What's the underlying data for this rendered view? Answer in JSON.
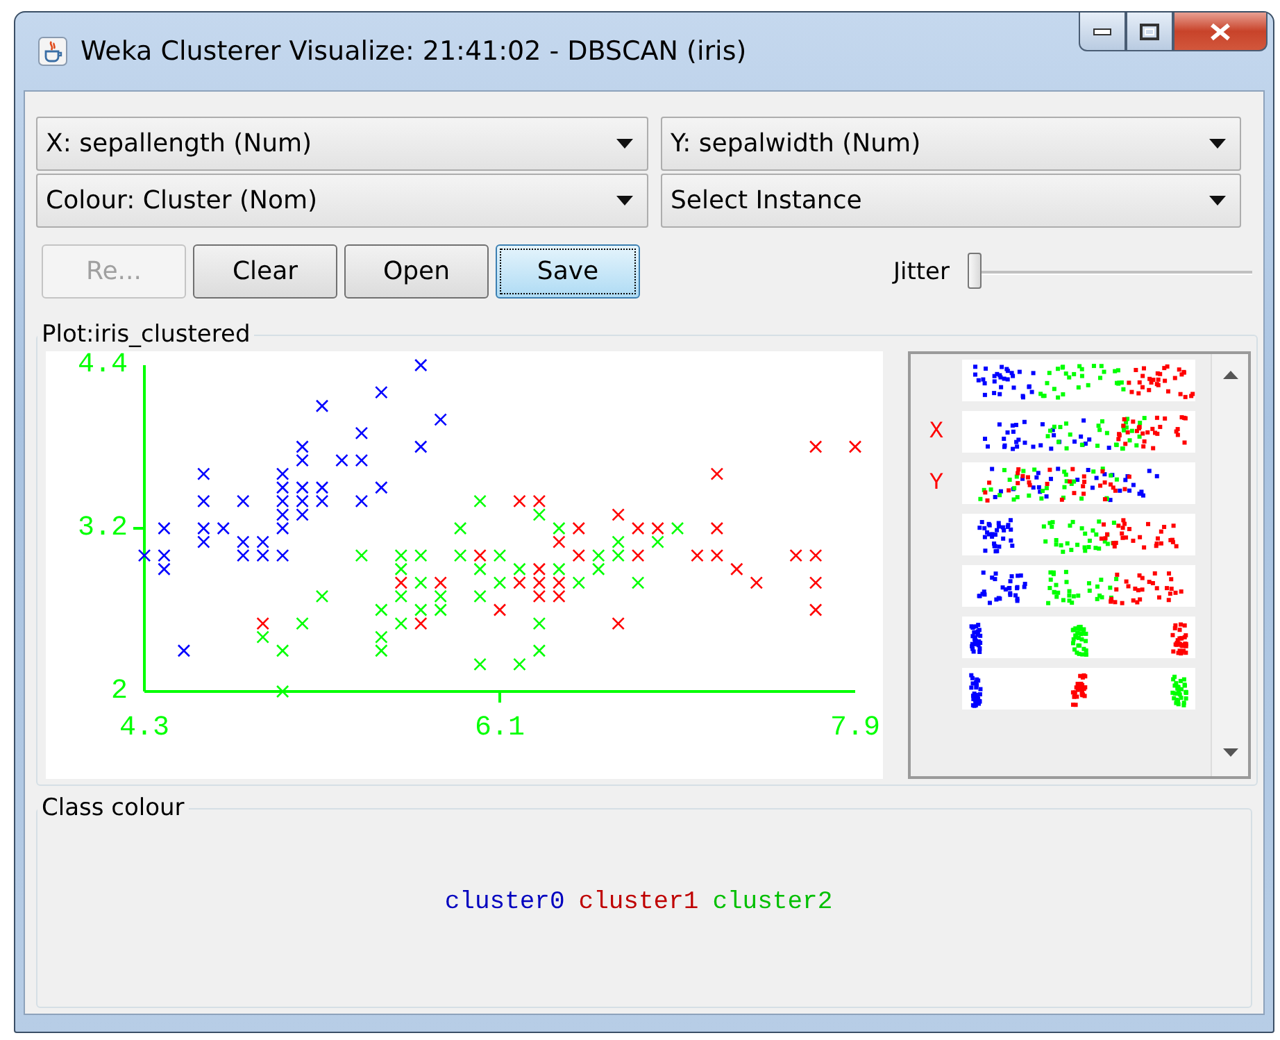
{
  "window": {
    "title": "Weka Clusterer Visualize: 21:41:02 - DBSCAN (iris)"
  },
  "selectors": [
    {
      "text": "X: sepallength (Num)"
    },
    {
      "text": "Y: sepalwidth (Num)"
    },
    {
      "text": "Colour: Cluster (Nom)"
    },
    {
      "text": "Select Instance"
    }
  ],
  "buttons": [
    {
      "label": "Re...",
      "disabled": true,
      "focused": false
    },
    {
      "label": "Clear",
      "disabled": false,
      "focused": false
    },
    {
      "label": "Open",
      "disabled": false,
      "focused": false
    },
    {
      "label": "Save",
      "disabled": false,
      "focused": true
    }
  ],
  "jitter": {
    "label": "Jitter",
    "level": 0
  },
  "plot": {
    "title": "Plot:iris_clustered",
    "chart_data": {
      "type": "scatter",
      "xlim": [
        4.3,
        7.9
      ],
      "ylim": [
        2,
        4.4
      ],
      "xticks": [
        {
          "value": 4.3,
          "label": "4.3"
        },
        {
          "value": 6.1,
          "label": "6.1"
        },
        {
          "value": 7.9,
          "label": "7.9"
        }
      ],
      "yticks": [
        {
          "value": 2,
          "label": "2"
        },
        {
          "value": 3.2,
          "label": "3.2"
        },
        {
          "value": 4.4,
          "label": "4.4"
        }
      ],
      "series": [
        {
          "name": "cluster0",
          "color": "#0000ff",
          "x": [
            4.3,
            4.4,
            4.4,
            4.4,
            4.5,
            4.6,
            4.6,
            4.6,
            4.6,
            4.7,
            4.8,
            4.8,
            4.8,
            4.9,
            4.9,
            5.0,
            5.0,
            5.0,
            5.0,
            5.0,
            5.0,
            5.1,
            5.1,
            5.1,
            5.1,
            5.1,
            5.2,
            5.2,
            5.2,
            5.3,
            5.4,
            5.4,
            5.4,
            5.5,
            5.5,
            5.7,
            5.7,
            5.8
          ],
          "values": [
            3.0,
            3.2,
            3.0,
            2.9,
            2.3,
            3.6,
            3.4,
            3.2,
            3.1,
            3.2,
            3.4,
            3.1,
            3.0,
            3.1,
            3.0,
            3.6,
            3.5,
            3.4,
            3.3,
            3.2,
            3.0,
            3.8,
            3.7,
            3.5,
            3.4,
            3.3,
            4.1,
            3.5,
            3.4,
            3.7,
            3.9,
            3.7,
            3.4,
            4.2,
            3.5,
            4.4,
            3.8,
            4.0
          ]
        },
        {
          "name": "cluster1",
          "color": "#ff0000",
          "x": [
            4.9,
            5.6,
            5.7,
            5.8,
            6.0,
            6.1,
            6.2,
            6.2,
            6.3,
            6.3,
            6.3,
            6.3,
            6.4,
            6.4,
            6.4,
            6.5,
            6.5,
            6.7,
            6.7,
            6.8,
            6.8,
            6.9,
            7.1,
            7.2,
            7.2,
            7.2,
            7.3,
            7.4,
            7.6,
            7.7,
            7.7,
            7.7,
            7.7,
            7.9
          ],
          "values": [
            2.5,
            2.8,
            2.5,
            2.8,
            3.0,
            2.6,
            3.4,
            2.8,
            3.4,
            2.9,
            2.8,
            2.7,
            3.1,
            2.8,
            2.7,
            3.2,
            3.0,
            3.3,
            2.5,
            3.2,
            3.0,
            3.2,
            3.0,
            3.6,
            3.2,
            3.0,
            2.9,
            2.8,
            3.0,
            3.8,
            3.0,
            2.8,
            2.6,
            3.8
          ]
        },
        {
          "name": "cluster2",
          "color": "#00ff00",
          "x": [
            4.9,
            5.0,
            5.0,
            5.1,
            5.2,
            5.4,
            5.5,
            5.5,
            5.5,
            5.6,
            5.6,
            5.6,
            5.6,
            5.7,
            5.7,
            5.7,
            5.8,
            5.8,
            5.9,
            5.9,
            6.0,
            6.0,
            6.0,
            6.0,
            6.1,
            6.1,
            6.2,
            6.2,
            6.3,
            6.3,
            6.3,
            6.4,
            6.4,
            6.5,
            6.6,
            6.6,
            6.7,
            6.7,
            6.8,
            6.9,
            7.0
          ],
          "values": [
            2.4,
            2.3,
            2.0,
            2.5,
            2.7,
            3.0,
            2.6,
            2.4,
            2.3,
            3.0,
            2.9,
            2.7,
            2.5,
            3.0,
            2.8,
            2.6,
            2.7,
            2.6,
            3.2,
            3.0,
            3.4,
            2.9,
            2.7,
            2.2,
            3.0,
            2.8,
            2.9,
            2.2,
            3.3,
            2.5,
            2.3,
            3.2,
            2.9,
            2.8,
            3.0,
            2.9,
            3.1,
            3.0,
            2.8,
            3.1,
            3.2
          ]
        }
      ]
    }
  },
  "attribute_panel": {
    "rows": [
      {
        "kind": "strip"
      },
      {
        "kind": "strip",
        "marker": "X"
      },
      {
        "kind": "strip",
        "marker": "Y"
      },
      {
        "kind": "strip"
      },
      {
        "kind": "strip"
      },
      {
        "kind": "strip"
      },
      {
        "kind": "strip"
      }
    ]
  },
  "class_colour": {
    "title": "Class colour"
  }
}
